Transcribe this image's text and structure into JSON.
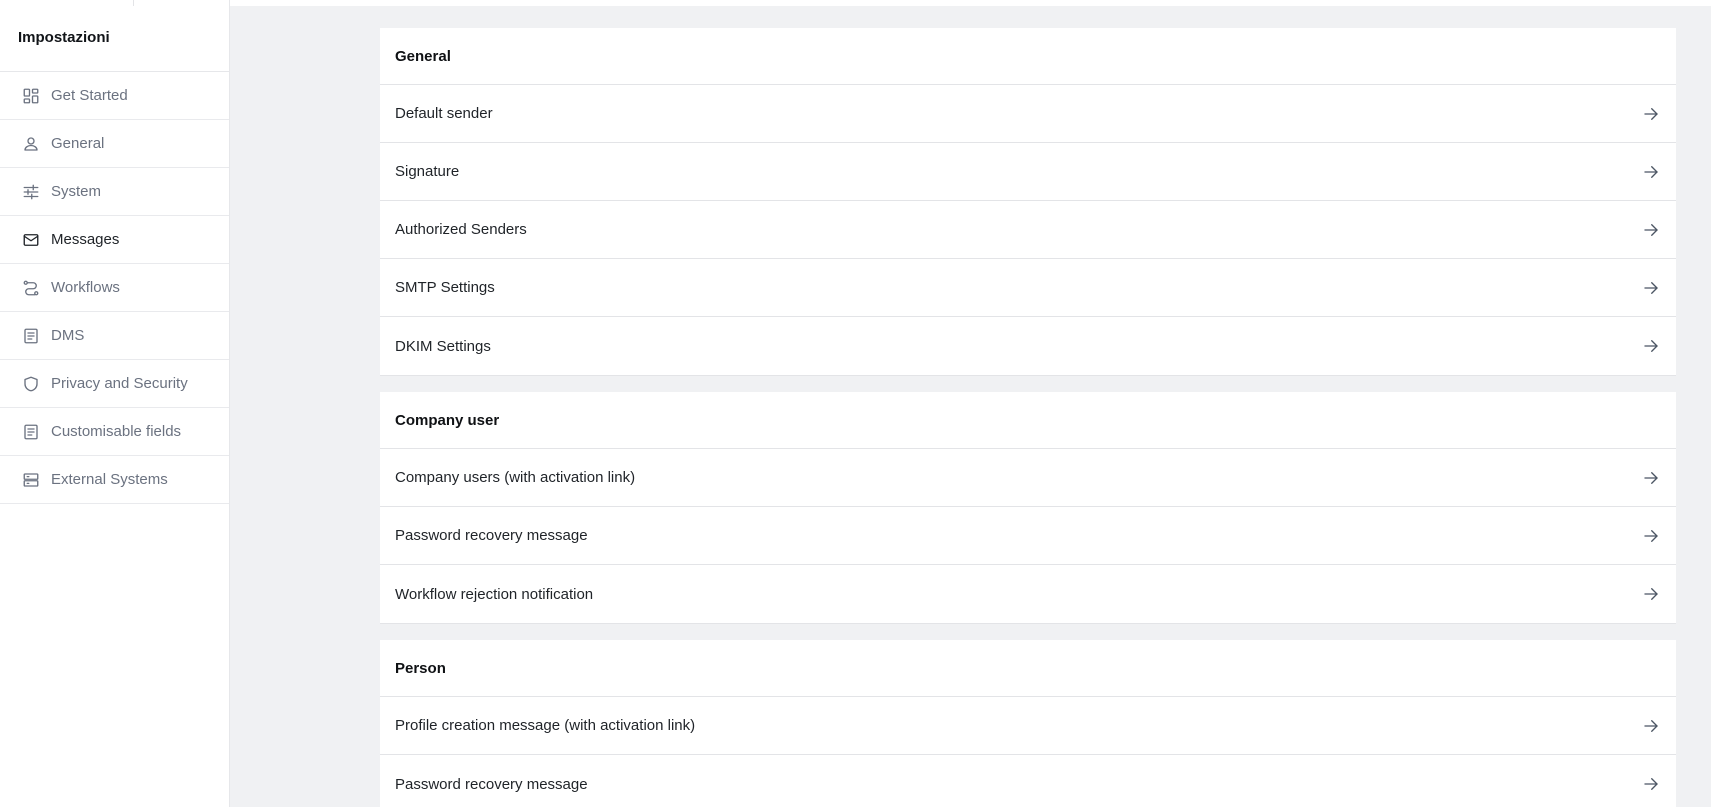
{
  "sidebar": {
    "title": "Impostazioni",
    "items": [
      {
        "label": "Get Started",
        "icon": "dashboard-icon",
        "active": false
      },
      {
        "label": "General",
        "icon": "user-icon",
        "active": false
      },
      {
        "label": "System",
        "icon": "sliders-icon",
        "active": false
      },
      {
        "label": "Messages",
        "icon": "mail-icon",
        "active": true
      },
      {
        "label": "Workflows",
        "icon": "route-icon",
        "active": false
      },
      {
        "label": "DMS",
        "icon": "document-icon",
        "active": false
      },
      {
        "label": "Privacy and Security",
        "icon": "shield-icon",
        "active": false
      },
      {
        "label": "Customisable fields",
        "icon": "document-icon",
        "active": false
      },
      {
        "label": "External Systems",
        "icon": "server-icon",
        "active": false
      }
    ]
  },
  "sections": [
    {
      "title": "General",
      "rows": [
        {
          "label": "Default sender"
        },
        {
          "label": "Signature"
        },
        {
          "label": "Authorized Senders"
        },
        {
          "label": "SMTP Settings"
        },
        {
          "label": "DKIM Settings"
        }
      ]
    },
    {
      "title": "Company user",
      "rows": [
        {
          "label": "Company users (with activation link)"
        },
        {
          "label": "Password recovery message"
        },
        {
          "label": "Workflow rejection notification"
        }
      ]
    },
    {
      "title": "Person",
      "rows": [
        {
          "label": "Profile creation message (with activation link)"
        },
        {
          "label": "Password recovery message"
        }
      ]
    }
  ],
  "colors": {
    "background": "#f0f1f3",
    "panel": "#ffffff",
    "muted_text": "#6b7280",
    "active_text": "#1f2328",
    "divider": "#e3e4e7"
  }
}
